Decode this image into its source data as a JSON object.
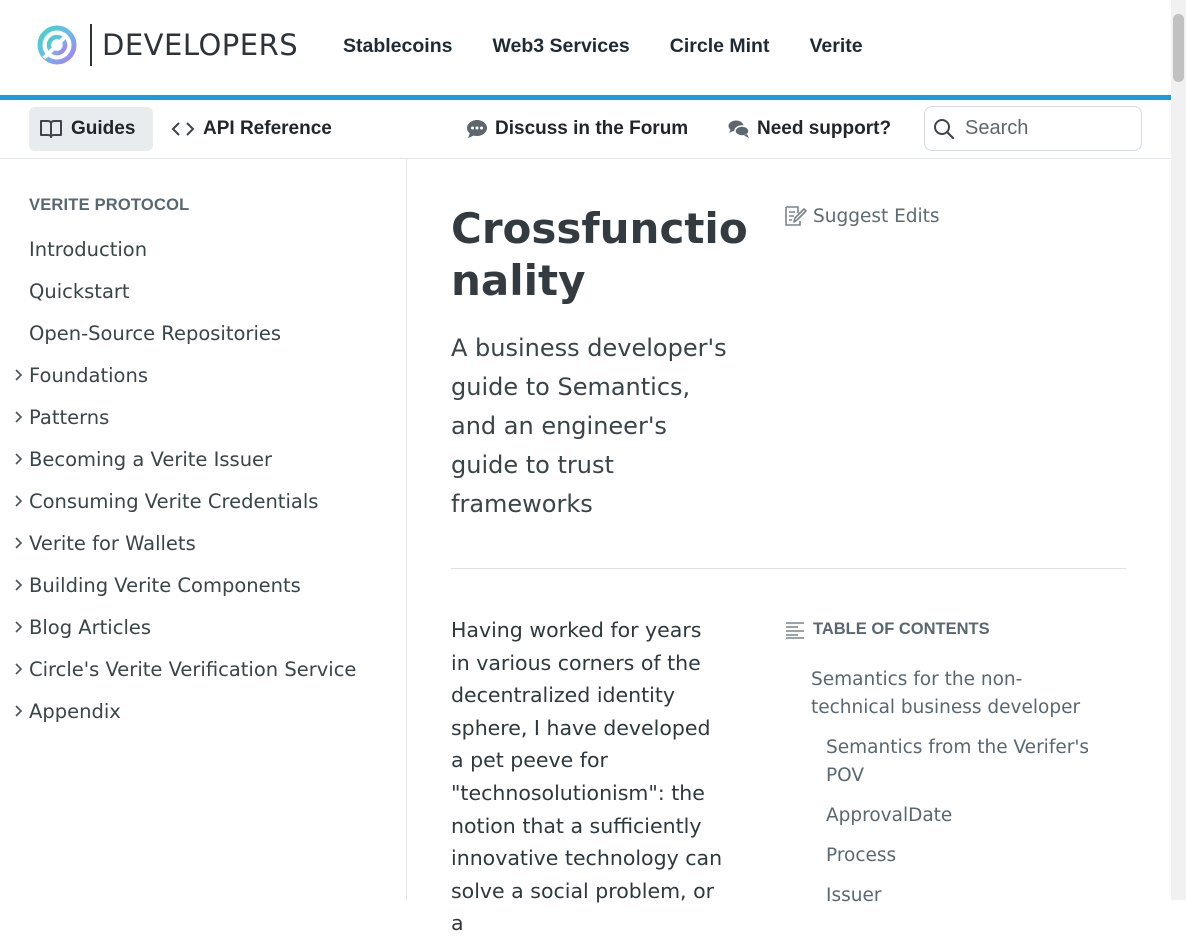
{
  "header": {
    "logo_text": "DEVELOPERS",
    "nav": [
      "Stablecoins",
      "Web3 Services",
      "Circle Mint",
      "Verite"
    ],
    "accent_color": "#1a9cdf"
  },
  "subheader": {
    "guides": "Guides",
    "api_reference": "API Reference",
    "forum": "Discuss in the Forum",
    "support": "Need support?",
    "search_placeholder": "Search"
  },
  "sidebar": {
    "heading": "VERITE PROTOCOL",
    "items": [
      {
        "label": "Introduction",
        "expandable": false
      },
      {
        "label": "Quickstart",
        "expandable": false
      },
      {
        "label": "Open-Source Repositories",
        "expandable": false
      },
      {
        "label": "Foundations",
        "expandable": true
      },
      {
        "label": "Patterns",
        "expandable": true
      },
      {
        "label": "Becoming a Verite Issuer",
        "expandable": true
      },
      {
        "label": "Consuming Verite Credentials",
        "expandable": true
      },
      {
        "label": "Verite for Wallets",
        "expandable": true
      },
      {
        "label": "Building Verite Components",
        "expandable": true
      },
      {
        "label": "Blog Articles",
        "expandable": true
      },
      {
        "label": "Circle's Verite Verification Service",
        "expandable": true
      },
      {
        "label": "Appendix",
        "expandable": true
      }
    ]
  },
  "main": {
    "title": "Crossfunctionality",
    "subtitle": "A business developer's guide to Semantics, and an engineer's guide to trust frameworks",
    "suggest_edits": "Suggest Edits",
    "body": "Having worked for years in various corners of the decentralized identity sphere, I have developed a pet peeve for \"technosolutionism\": the notion that a sufficiently innovative technology can solve a social problem, or a"
  },
  "toc": {
    "heading": "TABLE OF CONTENTS",
    "items": [
      {
        "label": "Semantics for the non-technical business developer",
        "level": 1
      },
      {
        "label": "Semantics from the Verifer's POV",
        "level": 2
      },
      {
        "label": "ApprovalDate",
        "level": 2
      },
      {
        "label": "Process",
        "level": 2
      },
      {
        "label": "Issuer",
        "level": 2
      }
    ]
  }
}
